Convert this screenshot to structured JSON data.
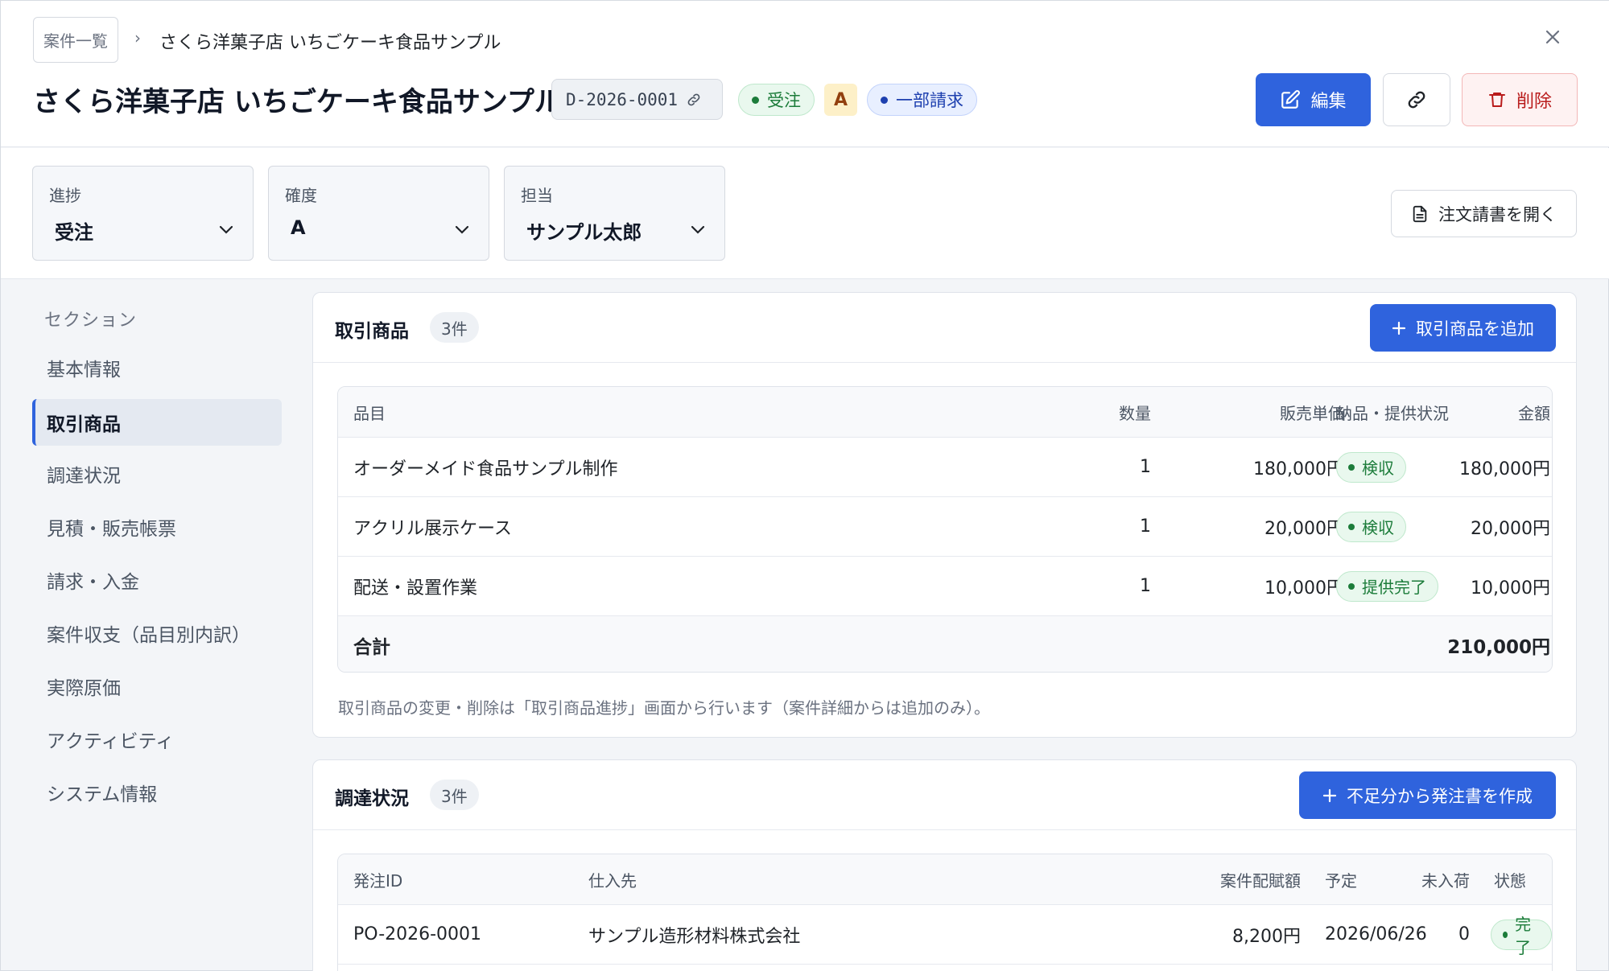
{
  "breadcrumb": {
    "parent": "案件一覧",
    "separator": "›",
    "current": "さくら洋菓子店 いちごケーキ食品サンプル"
  },
  "header": {
    "title": "さくら洋菓子店 いちごケーキ食品サンプル",
    "code": "D-2026-0001",
    "status_label": "受注",
    "rank": "A",
    "billing_label": "一部請求",
    "edit_label": "編集",
    "delete_label": "削除"
  },
  "filters": {
    "progress": {
      "label": "進捗",
      "value": "受注"
    },
    "certainty": {
      "label": "確度",
      "value": "A"
    },
    "owner": {
      "label": "担当",
      "value": "サンプル太郎"
    },
    "open_order_label": "注文請書を開く"
  },
  "sidebar": {
    "heading": "セクション",
    "items": [
      {
        "label": "基本情報"
      },
      {
        "label": "取引商品"
      },
      {
        "label": "調達状況"
      },
      {
        "label": "見積・販売帳票"
      },
      {
        "label": "請求・入金"
      },
      {
        "label": "案件収支（品目別内訳）"
      },
      {
        "label": "実際原価"
      },
      {
        "label": "アクティビティ"
      },
      {
        "label": "システム情報"
      }
    ]
  },
  "products": {
    "title": "取引商品",
    "count": "3件",
    "add_label": "取引商品を追加",
    "columns": {
      "item": "品目",
      "qty": "数量",
      "price": "販売単価",
      "amount": "金額",
      "status": "納品・提供状況"
    },
    "rows": [
      {
        "item": "オーダーメイド食品サンプル制作",
        "qty": "1",
        "price": "180,000円",
        "amount": "180,000円",
        "status": "検収"
      },
      {
        "item": "アクリル展示ケース",
        "qty": "1",
        "price": "20,000円",
        "amount": "20,000円",
        "status": "検収"
      },
      {
        "item": "配送・設置作業",
        "qty": "1",
        "price": "10,000円",
        "amount": "10,000円",
        "status": "提供完了"
      }
    ],
    "total_label": "合計",
    "total_value": "210,000円",
    "note": "取引商品の変更・削除は「取引商品進捗」画面から行います（案件詳細からは追加のみ）。"
  },
  "procurement": {
    "title": "調達状況",
    "count": "3件",
    "create_label": "不足分から発注書を作成",
    "columns": {
      "po_id": "発注ID",
      "supplier": "仕入先",
      "allocated": "案件配賦額",
      "scheduled": "予定",
      "pending": "未入荷",
      "state": "状態"
    },
    "rows": [
      {
        "po_id": "PO-2026-0001",
        "supplier": "サンプル造形材料株式会社",
        "allocated": "8,200円",
        "scheduled": "2026/06/26",
        "pending": "0",
        "state": "完了"
      }
    ]
  },
  "colors": {
    "primary": "#2f63dd",
    "success": "#1c7c3a",
    "danger": "#b91c1c",
    "rank_bg": "#fdf0c8"
  }
}
